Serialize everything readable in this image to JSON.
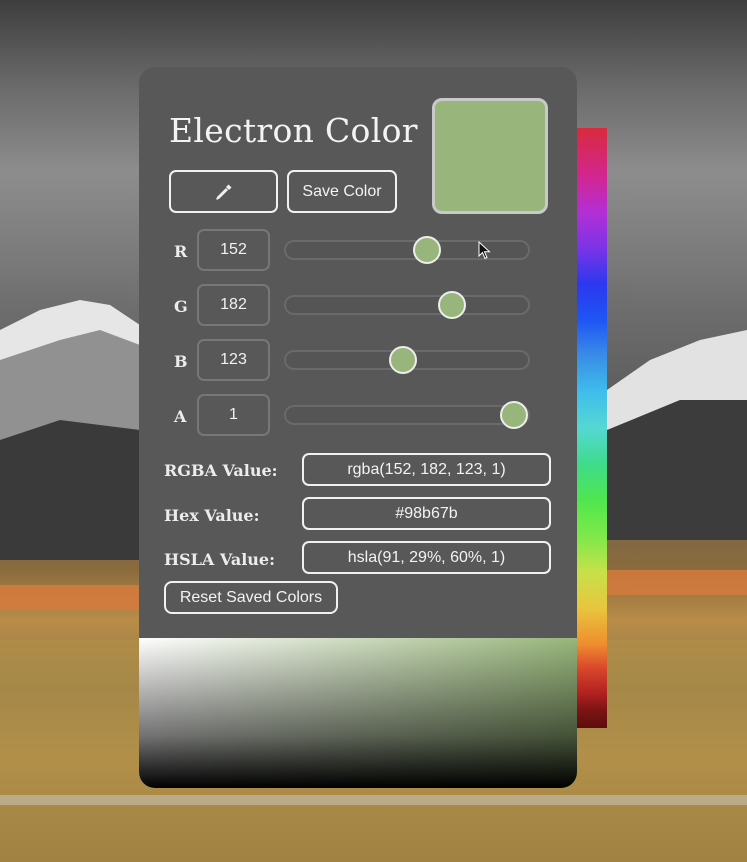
{
  "app": {
    "title": "Electron Color",
    "current_color_hex": "#98b67b",
    "accent_color": "#98b67b"
  },
  "toolbar": {
    "picker_icon": "eyedropper-icon",
    "save_label": "Save Color",
    "reset_label": "Reset Saved Colors"
  },
  "channels": [
    {
      "label": "R",
      "value": "152",
      "fraction": 0.593
    },
    {
      "label": "G",
      "value": "182",
      "fraction": 0.711
    },
    {
      "label": "B",
      "value": "123",
      "fraction": 0.479
    },
    {
      "label": "A",
      "value": "1",
      "fraction": 1.0
    }
  ],
  "values": {
    "rgba_label": "RGBA Value:",
    "rgba": "rgba(152, 182, 123, 1)",
    "hex_label": "Hex Value:",
    "hex": "#98b67b",
    "hsla_label": "HSLA Value:",
    "hsla": "hsla(91, 29%, 60%, 1)"
  }
}
